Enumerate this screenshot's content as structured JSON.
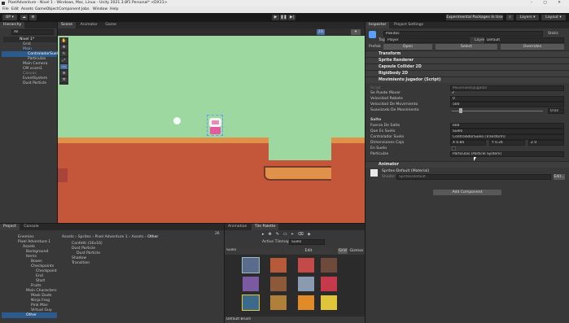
{
  "window": {
    "title": "PixelAdventure - Nivel 1 - Windows, Mac, Linux - Unity 2021.3.8f1 Personal* <DX11>"
  },
  "menu": [
    "File",
    "Edit",
    "Assets",
    "GameObject",
    "Component",
    "Jobs",
    "Window",
    "Help"
  ],
  "toolbar": {
    "account": "BP",
    "experimental": "Experimental Packages In Use",
    "layers": "Layers",
    "layout": "Layout"
  },
  "hierarchy": {
    "tab": "Hierarchy",
    "search": "All",
    "items": [
      "Nivel 1*",
      "Grid",
      "Main",
      "ControladorSuelo",
      "Particulas",
      "Main Camera",
      "CM vcam1",
      "Canvas",
      "EventSystem",
      "Dust Particle"
    ]
  },
  "scene": {
    "tabs": [
      "Scene",
      "Animator",
      "Game"
    ],
    "toolbar_2d": "2D",
    "gizmo_label": "▾"
  },
  "project": {
    "tabs": [
      "Project",
      "Console"
    ],
    "count": "26",
    "tree": [
      "Enemies",
      "Pixel Adventure 1",
      "Assets",
      "Background",
      "Items",
      "Boxes",
      "Checkpoints",
      "Checkpoint",
      "End",
      "Start",
      "Fruits",
      "Main Characters",
      "Mask Dude",
      "Ninja Frog",
      "Pink Man",
      "Virtual Guy",
      "Other"
    ],
    "breadcrumb": [
      "Assets",
      "Sprites",
      "Pixel Adventure 1",
      "Assets",
      "Other"
    ],
    "files": [
      "Confetti (16x16)",
      "Dust Particle",
      "Dust Particle",
      "Shadow",
      "Transition"
    ]
  },
  "palette": {
    "tabs": [
      "Animation",
      "Tile Palette"
    ],
    "active_tilemap_label": "Active Tilemap",
    "active_tilemap": "Suelo",
    "palette_name": "Suelo",
    "edit": "Edit",
    "grid": "Grid",
    "gizmos": "Gizmos",
    "default_brush": "Default Brush"
  },
  "inspector": {
    "tabs": [
      "Inspector",
      "Project Settings"
    ],
    "name": "Piskitos",
    "static": "Static",
    "tag_label": "Tag",
    "tag": "Player",
    "layer_label": "Layer",
    "layer": "Default",
    "prefab_label": "Prefab",
    "prefab_open": "Open",
    "prefab_select": "Select",
    "prefab_overrides": "Overrides",
    "components": [
      "Transform",
      "Sprite Renderer",
      "Capsule Collider 2D",
      "Rigidbody 2D",
      "Movimiento Jugador (Script)"
    ],
    "script_label": "Script",
    "script_value": "MovimientoJugador",
    "fields": [
      {
        "label": "Se Puede Mover",
        "value": "✓"
      },
      {
        "label": "Velocidad Rebote",
        "value": "0"
      },
      {
        "label": "Velocidad De Movimiento",
        "value": "500"
      },
      {
        "label": "Suavizado De Movimiento",
        "value": "0.03"
      }
    ],
    "salto_header": "Salto",
    "salto_fields": [
      {
        "label": "Fuerza De Salto",
        "value": "600"
      },
      {
        "label": "Que Es Suelo",
        "value": "Suelo"
      },
      {
        "label": "Controlador Suelo",
        "value": "ControladorSuelo (Transform)"
      },
      {
        "label": "Dimensiones Caja",
        "x": "0.84",
        "y": "0.24",
        "z": "0"
      },
      {
        "label": "En Suelo",
        "value": ""
      },
      {
        "label": "Particulas",
        "value": "Particulas (Particle System)"
      }
    ],
    "animator": "Animator",
    "material": "Sprites-Default (Material)",
    "shader_label": "Shader",
    "shader": "Sprites/Default",
    "shader_edit": "Edit...",
    "add_component": "Add Component"
  },
  "colors": {
    "sky": "#9dd8a0",
    "dirt": "#c4563a",
    "grass": "#e0914a",
    "accent_blue": "#3a7bd5"
  }
}
